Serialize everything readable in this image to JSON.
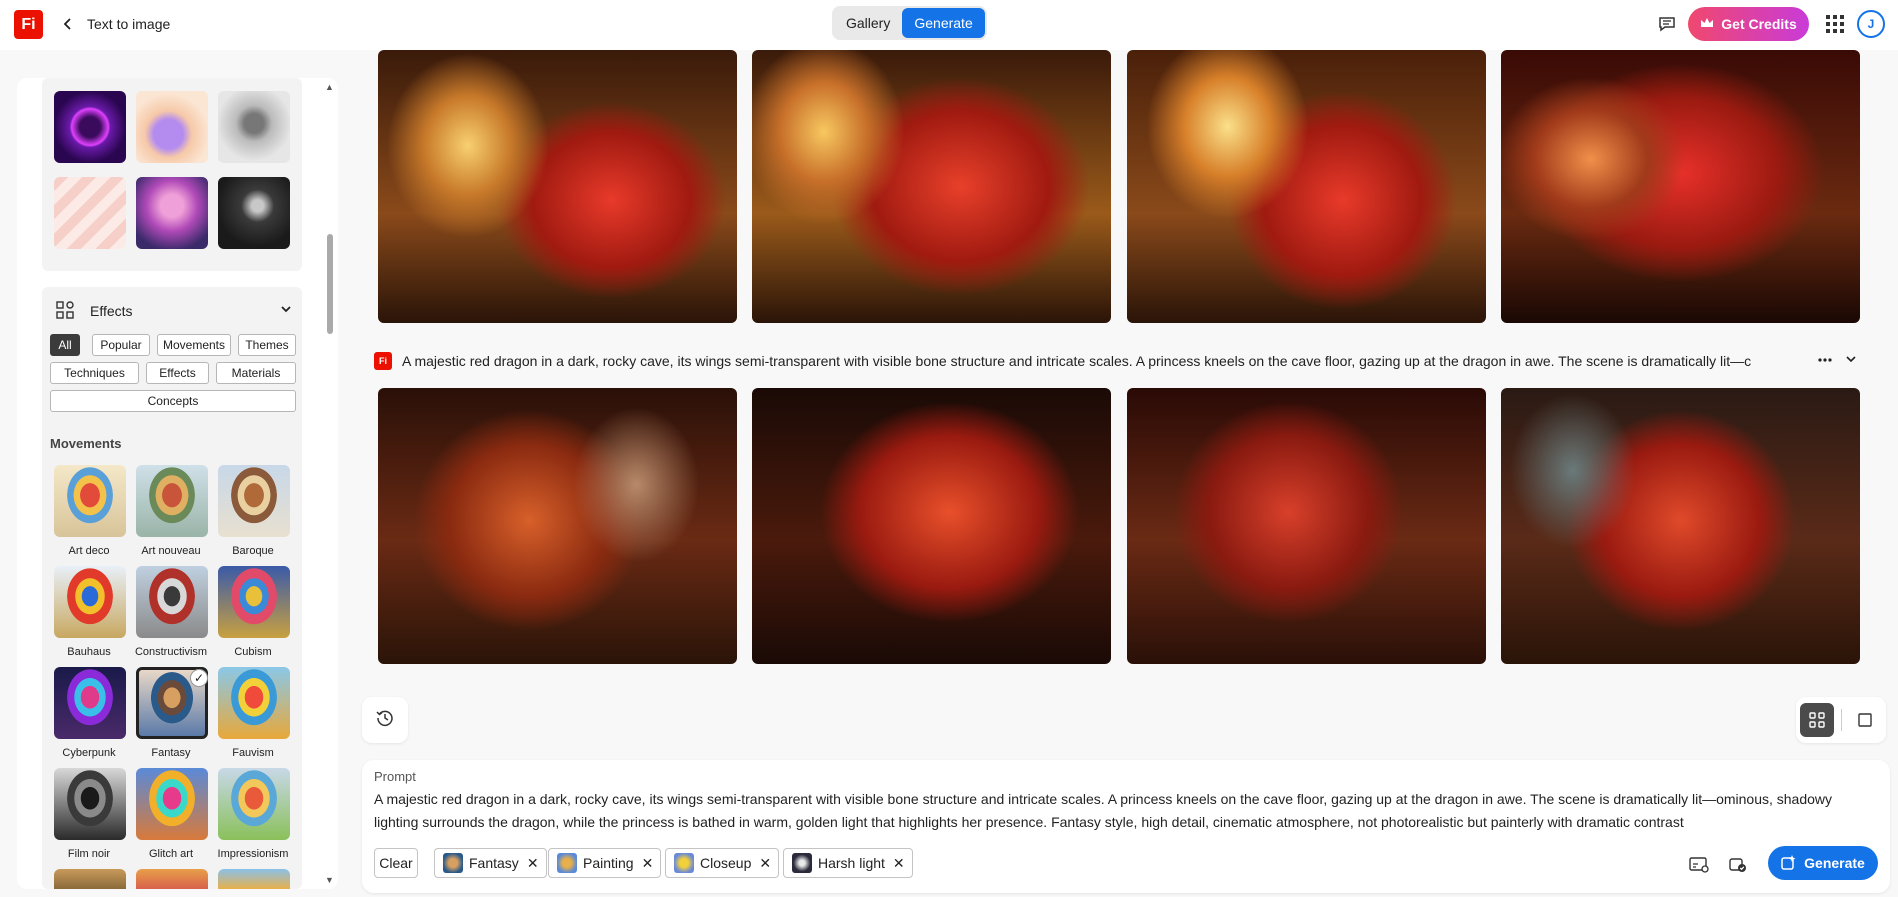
{
  "header": {
    "logo_text": "Fi",
    "title": "Text to image",
    "tabs": [
      {
        "label": "Gallery"
      },
      {
        "label": "Generate"
      }
    ],
    "credits_label": "Get Credits",
    "avatar_initial": "J"
  },
  "panel": {
    "effects_title": "Effects",
    "chips": [
      "All",
      "Popular",
      "Movements",
      "Themes",
      "Techniques",
      "Effects",
      "Materials",
      "Concepts"
    ],
    "section_label": "Movements",
    "styles": [
      "Art deco",
      "Art nouveau",
      "Baroque",
      "Bauhaus",
      "Constructivism",
      "Cubism",
      "Cyberpunk",
      "Fantasy",
      "Fauvism",
      "Film noir",
      "Glitch art",
      "Impressionism"
    ],
    "selected_style": "Fantasy"
  },
  "gallery": {
    "prompt": "A majestic red dragon in a dark, rocky cave, its wings semi-transparent with visible bone structure and intricate scales. A princess kneels on the cave floor, gazing up at the dragon in awe. The scene is dramatically lit—c"
  },
  "prompt_box": {
    "label": "Prompt",
    "text": "A majestic red dragon in a dark, rocky cave, its wings semi-transparent with visible bone structure and intricate scales. A princess kneels on the cave floor, gazing up at the dragon in awe. The scene is dramatically lit—ominous, shadowy lighting surrounds the dragon, while the princess is bathed in warm, golden light that highlights her presence. Fantasy style, high detail, cinematic atmosphere, not photorealistic but painterly with dramatic contrast",
    "clear_label": "Clear",
    "tags": [
      "Fantasy",
      "Painting",
      "Closeup",
      "Harsh light"
    ],
    "generate_label": "Generate"
  },
  "colors": {
    "accent": "#1473e6",
    "brand": "#eb1000"
  }
}
